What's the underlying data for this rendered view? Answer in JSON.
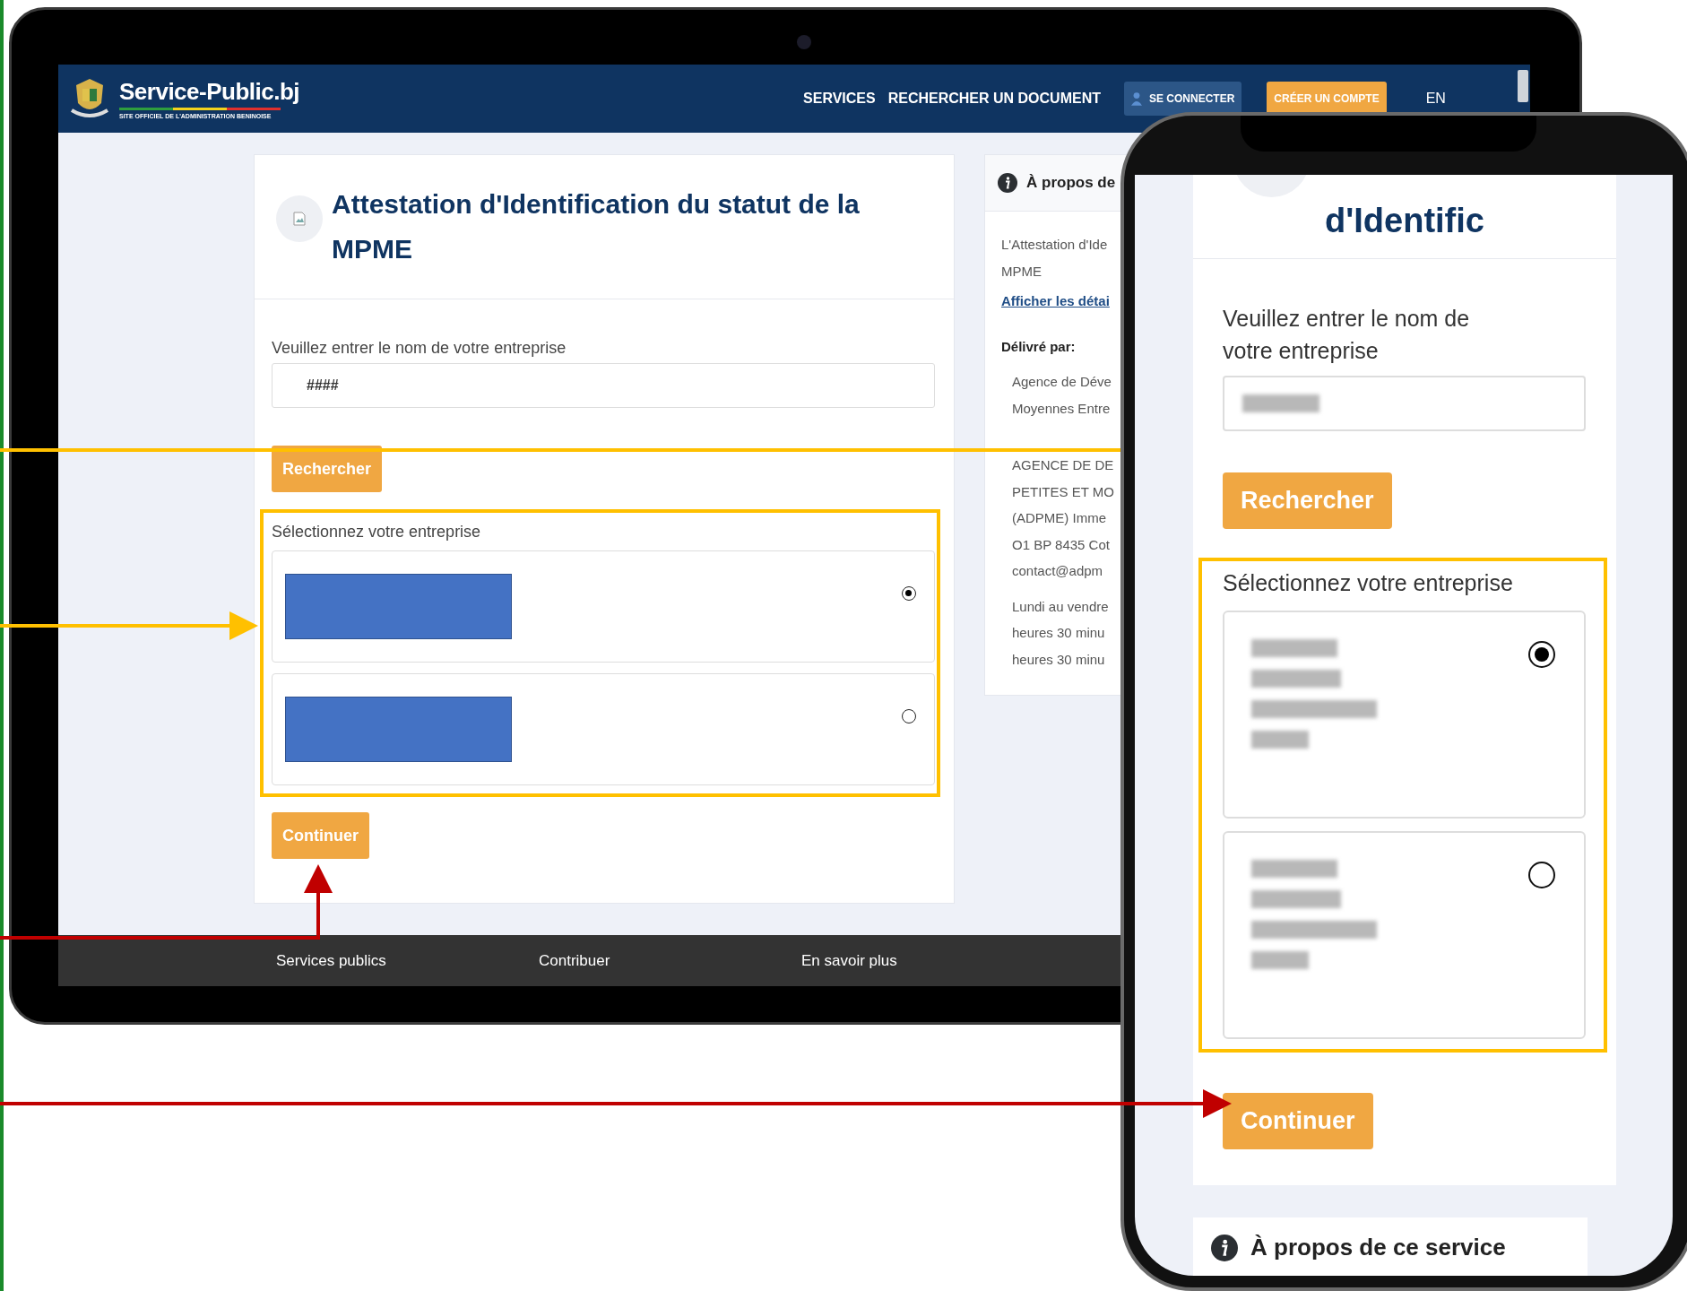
{
  "laptop": {
    "header": {
      "site_name": "Service-Public.bj",
      "tagline": "SITE OFFICIEL DE L'ADMINISTRATION BENINOISE",
      "nav": [
        {
          "label": "SERVICES",
          "kind": "link"
        },
        {
          "label": "RECHERCHER UN DOCUMENT",
          "kind": "link"
        },
        {
          "label": "SE CONNECTER",
          "kind": "login"
        },
        {
          "label": "CRÉER UN COMPTE",
          "kind": "signup"
        },
        {
          "label": "EN",
          "kind": "link"
        }
      ]
    },
    "form": {
      "title_lines": [
        "Attestation d'Identification du statut de la",
        "MPME"
      ],
      "search_label": "Veuillez entrer le nom de votre entreprise",
      "search_value": "####",
      "search_button": "Rechercher",
      "select_label": "Sélectionnez votre entreprise",
      "options": [
        {
          "selected": true
        },
        {
          "selected": false
        }
      ],
      "continue_button": "Continuer"
    },
    "about": {
      "title": "À propos de",
      "description_lines": [
        "L'Attestation d'Ide",
        "MPME"
      ],
      "details_link": "Afficher les détai",
      "issuer_label": "Délivré par:",
      "issuer_lines": [
        [
          "Agence de Déve",
          "Moyennes Entre"
        ],
        [
          "AGENCE DE DE",
          "PETITES ET MO",
          "(ADPME) Imme",
          "O1 BP 8435 Cot",
          "contact@adpm"
        ],
        [
          "Lundi au vendre",
          "heures 30 minu",
          "heures 30 minu"
        ]
      ]
    },
    "footer": [
      "Services publics",
      "Contribuer",
      "En savoir plus"
    ]
  },
  "phone": {
    "title": "d'Identific",
    "search_label": "Veuillez entrer le nom de votre entreprise",
    "search_button": "Rechercher",
    "select_label": "Sélectionnez votre entreprise",
    "options": [
      {
        "selected": true
      },
      {
        "selected": false
      }
    ],
    "continue_button": "Continuer",
    "about_title": "À propos de ce service"
  }
}
